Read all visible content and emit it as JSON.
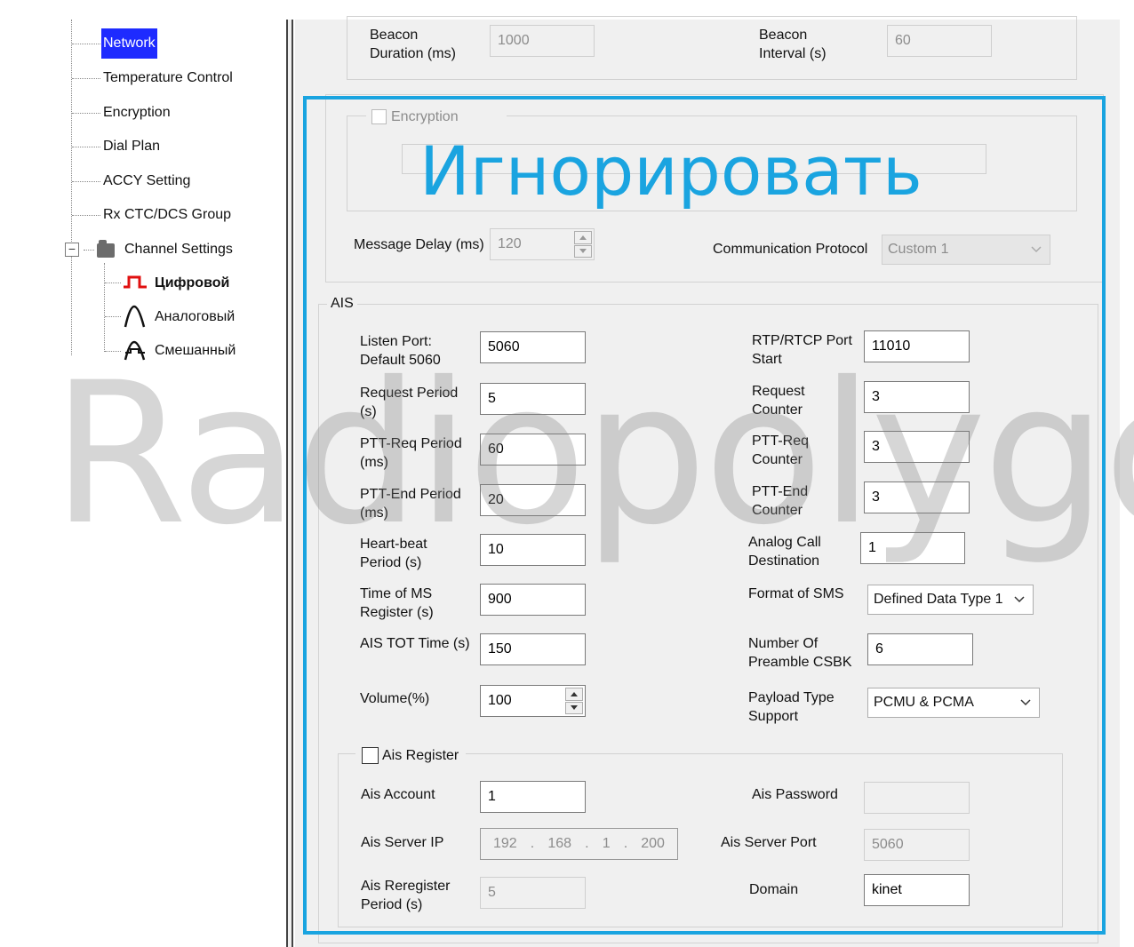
{
  "tree": {
    "items": [
      {
        "label": "Network",
        "selected": true
      },
      {
        "label": "Temperature Control"
      },
      {
        "label": "Encryption"
      },
      {
        "label": "Dial Plan"
      },
      {
        "label": "ACCY Setting"
      },
      {
        "label": "Rx CTC/DCS Group"
      }
    ],
    "channel_settings": {
      "label": "Channel Settings",
      "expander": "−",
      "children": [
        {
          "label": "Цифровой",
          "icon": "digital-wave-icon"
        },
        {
          "label": "Аналоговый",
          "icon": "analog-wave-icon"
        },
        {
          "label": "Смешанный",
          "icon": "mixed-wave-icon"
        }
      ]
    }
  },
  "beacon": {
    "duration_label": "Beacon\nDuration (ms)",
    "duration_value": "1000",
    "interval_label": "Beacon\nInterval (s)",
    "interval_value": "60"
  },
  "encryption": {
    "label": "Encryption",
    "checked": false,
    "key_value": ""
  },
  "message_delay": {
    "label": "Message Delay (ms)",
    "value": "120"
  },
  "comm_protocol": {
    "label": "Communication Protocol",
    "value": "Custom 1"
  },
  "ais": {
    "title": "AIS",
    "left": [
      {
        "label": "Listen Port:\nDefault 5060",
        "value": "5060"
      },
      {
        "label": "Request Period\n(s)",
        "value": "5"
      },
      {
        "label": "PTT-Req Period\n(ms)",
        "value": "60"
      },
      {
        "label": "PTT-End Period\n(ms)",
        "value": "20"
      },
      {
        "label": "Heart-beat\nPeriod (s)",
        "value": "10"
      },
      {
        "label": "Time of MS\nRegister (s)",
        "value": "900"
      },
      {
        "label": "AIS TOT Time (s)",
        "value": "150"
      },
      {
        "label": "Volume(%)",
        "value": "100"
      }
    ],
    "right": [
      {
        "label": "RTP/RTCP Port\nStart",
        "value": "11010"
      },
      {
        "label": "Request\nCounter",
        "value": "3"
      },
      {
        "label": "PTT-Req\nCounter",
        "value": "3"
      },
      {
        "label": "PTT-End\nCounter",
        "value": "3"
      },
      {
        "label": "Analog Call\nDestination",
        "value": "1"
      },
      {
        "label": "Format of SMS",
        "value": "Defined Data Type 1"
      },
      {
        "label": "Number Of\nPreamble CSBK",
        "value": "6"
      },
      {
        "label": "Payload Type\nSupport",
        "value": "PCMU & PCMA"
      }
    ],
    "register": {
      "checkbox_label": "Ais Register",
      "checked": false,
      "account_label": "Ais Account",
      "account_value": "1",
      "password_label": "Ais Password",
      "password_value": "",
      "server_ip_label": "Ais Server IP",
      "server_ip": [
        "192",
        ".",
        "168",
        ".",
        "1",
        ".",
        "200"
      ],
      "server_port_label": "Ais Server Port",
      "server_port_value": "5060",
      "reregister_label": "Ais Reregister\nPeriod (s)",
      "reregister_value": "5",
      "domain_label": "Domain",
      "domain_value": "kinet"
    }
  },
  "overlay": {
    "ignore_text": "Игнорировать",
    "watermark": "Radiopolygon.ru",
    "accent": "#1aa4e0"
  }
}
